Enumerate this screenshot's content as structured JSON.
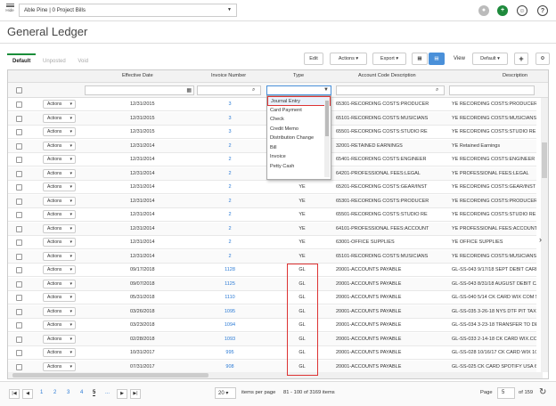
{
  "topbar": {
    "hide_label": "Hide",
    "project": "Able Pine | 0 Project Bills"
  },
  "page": {
    "title": "General Ledger"
  },
  "tabs": [
    "Default",
    "Unposted",
    "Void"
  ],
  "toolbar": {
    "edit": "Edit",
    "actions": "Actions ▾",
    "export": "Export ▾",
    "view_label": "View",
    "view_value": "Default ▾",
    "add": "+",
    "settings": "⚙"
  },
  "columns": [
    "Effective Date",
    "Invoice Number",
    "Type",
    "Account Code Description",
    "Description"
  ],
  "type_dropdown": [
    "Journal Entry",
    "Card Payment",
    "Check",
    "Credit Memo",
    "Distribution Change",
    "Bill",
    "Invoice",
    "Petty Cash"
  ],
  "rows": [
    {
      "date": "12/31/2015",
      "inv": "3",
      "type": "",
      "acct": "65301-RECORDING COSTS:PRODUCER",
      "desc": "YE RECORDING COSTS:PRODUCER"
    },
    {
      "date": "12/31/2015",
      "inv": "3",
      "type": "",
      "acct": "65101-RECORDING COSTS:MUSICIANS",
      "desc": "YE RECORDING COSTS:MUSICIANS"
    },
    {
      "date": "12/31/2015",
      "inv": "3",
      "type": "",
      "acct": "65501-RECORDING COSTS:STUDIO RE",
      "desc": "YE RECORDING COSTS:STUDIO RE"
    },
    {
      "date": "12/31/2014",
      "inv": "2",
      "type": "",
      "acct": "32001-RETAINED EARNINGS",
      "desc": "YE Retained Earnings"
    },
    {
      "date": "12/31/2014",
      "inv": "2",
      "type": "",
      "acct": "65401-RECORDING COSTS:ENGINEER",
      "desc": "YE RECORDING COSTS:ENGINEER"
    },
    {
      "date": "12/31/2014",
      "inv": "2",
      "type": "",
      "acct": "64201-PROFESSIONAL FEES:LEGAL",
      "desc": "YE PROFESSIONAL FEES:LEGAL"
    },
    {
      "date": "12/31/2014",
      "inv": "2",
      "type": "YE",
      "acct": "65201-RECORDING COSTS:GEAR/INST",
      "desc": "YE RECORDING COSTS:GEAR/INST"
    },
    {
      "date": "12/31/2014",
      "inv": "2",
      "type": "YE",
      "acct": "65301-RECORDING COSTS:PRODUCER",
      "desc": "YE RECORDING COSTS:PRODUCER"
    },
    {
      "date": "12/31/2014",
      "inv": "2",
      "type": "YE",
      "acct": "65501-RECORDING COSTS:STUDIO RE",
      "desc": "YE RECORDING COSTS:STUDIO RE"
    },
    {
      "date": "12/31/2014",
      "inv": "2",
      "type": "YE",
      "acct": "64101-PROFESSIONAL FEES:ACCOUNT",
      "desc": "YE PROFESSIONAL FEES:ACCOUNT"
    },
    {
      "date": "12/31/2014",
      "inv": "2",
      "type": "YE",
      "acct": "63001-OFFICE SUPPLIES",
      "desc": "YE OFFICE SUPPLIES"
    },
    {
      "date": "12/31/2014",
      "inv": "2",
      "type": "YE",
      "acct": "65101-RECORDING COSTS:MUSICIANS",
      "desc": "YE RECORDING COSTS:MUSICIANS"
    },
    {
      "date": "09/17/2018",
      "inv": "1128",
      "type": "GL",
      "acct": "20001-ACCOUNTS PAYABLE",
      "desc": "GL-SS-043 9/17/18 SEPT DEBIT CARD AC"
    },
    {
      "date": "09/07/2018",
      "inv": "1125",
      "type": "GL",
      "acct": "20001-ACCOUNTS PAYABLE",
      "desc": "GL-SS-043 8/31/18 AUGUST DEBIT CARD"
    },
    {
      "date": "05/31/2018",
      "inv": "1110",
      "type": "GL",
      "acct": "20001-ACCOUNTS PAYABLE",
      "desc": "GL-SS-040 5/14 CK CARD WIX COM 5-12"
    },
    {
      "date": "03/26/2018",
      "inv": "1095",
      "type": "GL",
      "acct": "20001-ACCOUNTS PAYABLE",
      "desc": "GL-SS-035 3-26-18 NYS DTF PIT TAX PAY"
    },
    {
      "date": "03/23/2018",
      "inv": "1094",
      "type": "GL",
      "acct": "20001-ACCOUNTS PAYABLE",
      "desc": "GL-SS-034 3-23-18 TRANSFER TO DEBIT"
    },
    {
      "date": "02/28/2018",
      "inv": "1093",
      "type": "GL",
      "acct": "20001-ACCOUNTS PAYABLE",
      "desc": "GL-SS-033 2-14-18 CK CARD WIX.COM C"
    },
    {
      "date": "10/31/2017",
      "inv": "995",
      "type": "GL",
      "acct": "20001-ACCOUNTS PAYABLE",
      "desc": "GL-SS-028 10/16/17 CK CARD WIX 10/15"
    },
    {
      "date": "07/31/2017",
      "inv": "908",
      "type": "GL",
      "acct": "20001-ACCOUNTS PAYABLE",
      "desc": "GL-SS-025 CK CARD SPOTIFY USA 6/8 CK"
    }
  ],
  "row_action_label": "Actions",
  "pager": {
    "pages": [
      "1",
      "2",
      "3",
      "4",
      "5",
      "..."
    ],
    "current": "5",
    "page_size": "20 ▾",
    "per_page_label": "items per page",
    "range": "81 - 100 of 3169 items",
    "page_label": "Page",
    "page_value": "5",
    "of_label": "of 159"
  }
}
